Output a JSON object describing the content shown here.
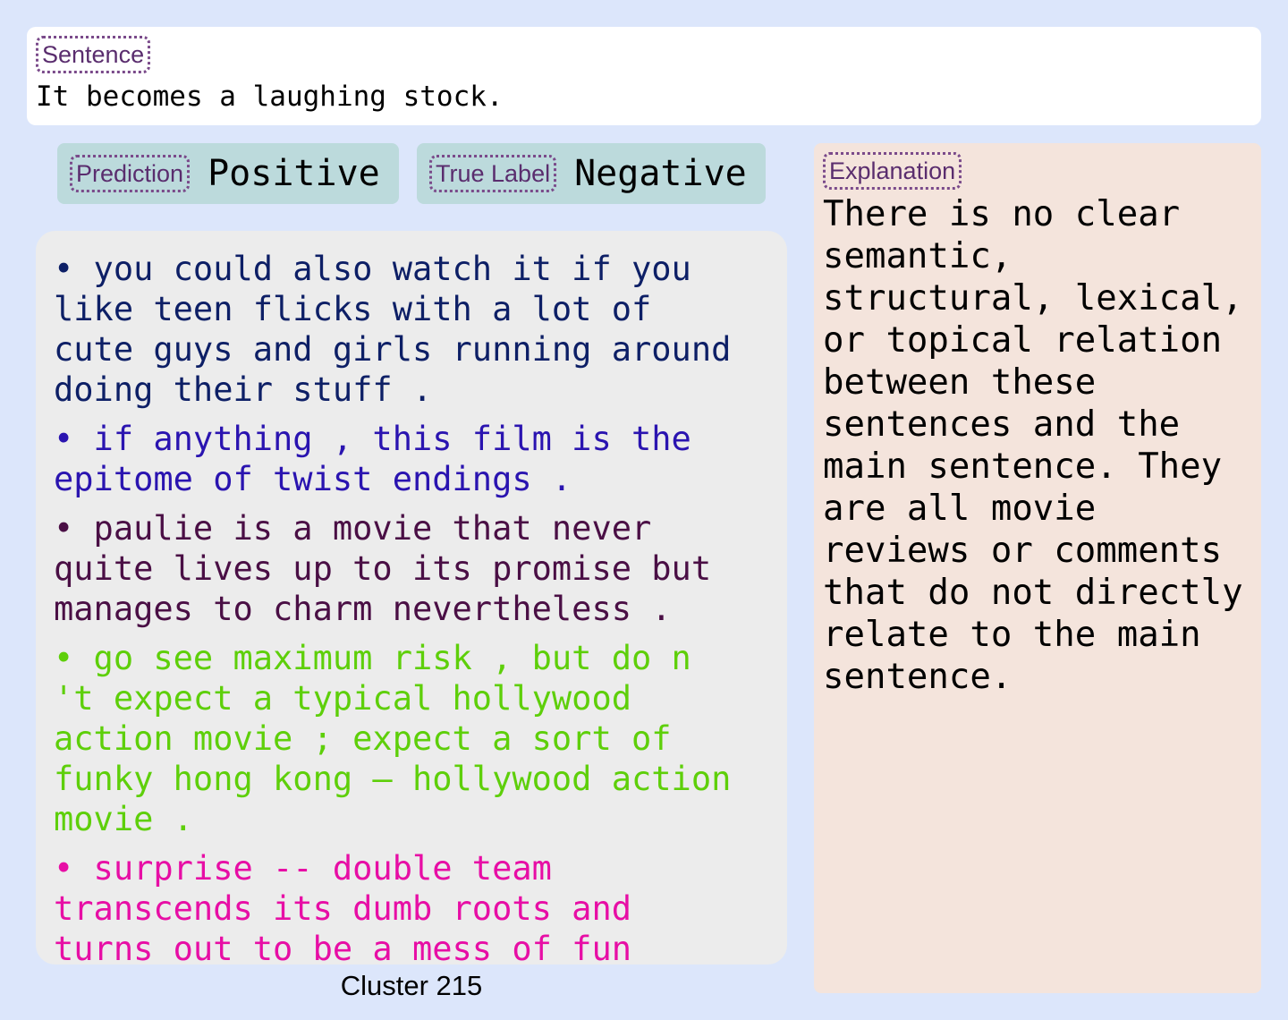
{
  "sentence": {
    "tag": "Sentence",
    "text": "It becomes a laughing stock."
  },
  "prediction": {
    "tag": "Prediction",
    "value": "Positive"
  },
  "true_label": {
    "tag": "True Label",
    "value": "Negative"
  },
  "cluster": {
    "items": [
      {
        "text": "• you could also watch it if you like teen flicks with a lot of cute guys and girls running around doing their stuff .",
        "color": "#0d1f66"
      },
      {
        "text": "• if anything , this film is the epitome of twist endings .",
        "color": "#2a14b0"
      },
      {
        "text": "• paulie is a movie that never quite lives up to its promise but manages to charm nevertheless .",
        "color": "#4a0f45"
      },
      {
        "text": "• go see maximum risk , but do n 't expect a typical hollywood action movie ; expect a sort of funky hong kong – hollywood action movie .",
        "color": "#5ecf0a"
      },
      {
        "text": "• surprise -- double team transcends its dumb roots and turns out to be a mess of fun",
        "color": "#e70ea5"
      }
    ],
    "caption": "Cluster 215"
  },
  "explanation": {
    "tag": "Explanation",
    "text": "There is no clear semantic, structural, lexical, or topical relation between these sentences and the main sentence. They are all movie reviews or comments that do not directly relate to the main sentence."
  }
}
